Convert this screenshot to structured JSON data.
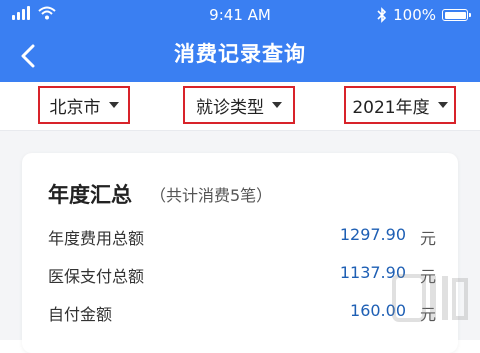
{
  "status_bar": {
    "time": "9:41 AM",
    "battery": "100%",
    "icons": [
      "signal-icon",
      "wifi-icon",
      "bluetooth-icon",
      "battery-icon"
    ]
  },
  "nav": {
    "title": "消费记录查询",
    "back_icon": "chevron-left-icon"
  },
  "filters": [
    {
      "label": "北京市"
    },
    {
      "label": "就诊类型"
    },
    {
      "label": "2021年度"
    }
  ],
  "summary": {
    "title": "年度汇总",
    "subtitle": "（共计消费5笔）",
    "rows": [
      {
        "label": "年度费用总额",
        "value": "1297.90",
        "unit": "元"
      },
      {
        "label": "医保支付总额",
        "value": "1137.90",
        "unit": "元"
      },
      {
        "label": "自付金额",
        "value": "160.00",
        "unit": "元"
      }
    ]
  },
  "colors": {
    "header": "#3a7ff2",
    "amount": "#1e5fb4",
    "highlight_border": "#d8232a"
  }
}
